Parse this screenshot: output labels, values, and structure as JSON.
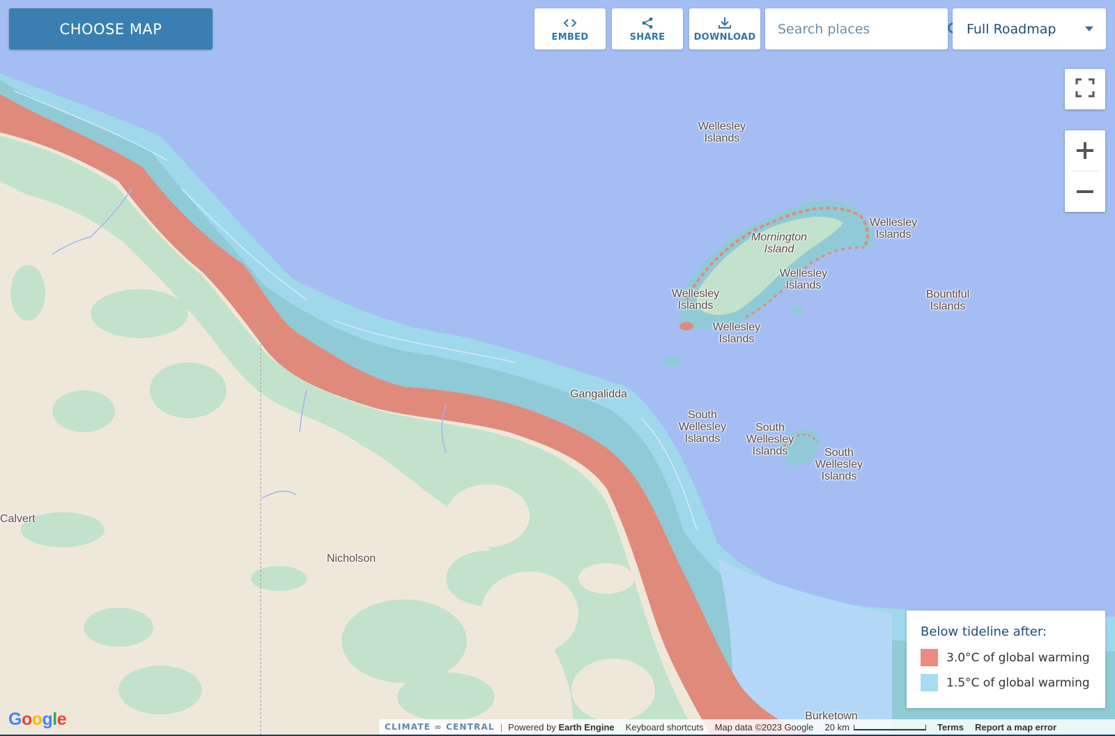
{
  "toolbar": {
    "choose_map": "CHOOSE MAP",
    "embed": "EMBED",
    "share": "SHARE",
    "download": "DOWNLOAD",
    "search_placeholder": "Search places",
    "basemap_selected": "Full Roadmap"
  },
  "labels": {
    "wellesley_top": "Wellesley\nIslands",
    "mornington": "Mornington\nIsland",
    "wellesley_ne": "Wellesley\nIslands",
    "wellesley_center": "Wellesley\nIslands",
    "wellesley_west": "Wellesley\nIslands",
    "wellesley_south": "Wellesley\nIslands",
    "bountiful": "Bountiful\nIslands",
    "gangalidda": "Gangalidda",
    "south_wellesley_1": "South\nWellesley\nIslands",
    "south_wellesley_2": "South\nWellesley\nIslands",
    "south_wellesley_3": "South\nWellesley\nIslands",
    "calvert": "Calvert",
    "nicholson": "Nicholson",
    "burketown": "Burketown"
  },
  "legend": {
    "title": "Below tideline after:",
    "items": [
      {
        "label": "3.0°C of global warming",
        "color": "#ee8b80"
      },
      {
        "label": "1.5°C of global warming",
        "color": "#a8dcf3"
      }
    ]
  },
  "footer": {
    "brand": "CLIMATE ∞ CENTRAL",
    "powered_prefix": "Powered by",
    "powered_engine": "Earth Engine",
    "keyboard": "Keyboard shortcuts",
    "map_data": "Map data ©2023 Google",
    "scale": "20 km",
    "terms": "Terms",
    "report": "Report a map error"
  },
  "colors": {
    "water": "#a4bef4",
    "land": "#efe8da",
    "vegetation": "#c3e2cb",
    "risk_3c": "#e08a7c",
    "risk_15c": "#8fd0db",
    "accent": "#3a7fb1"
  }
}
